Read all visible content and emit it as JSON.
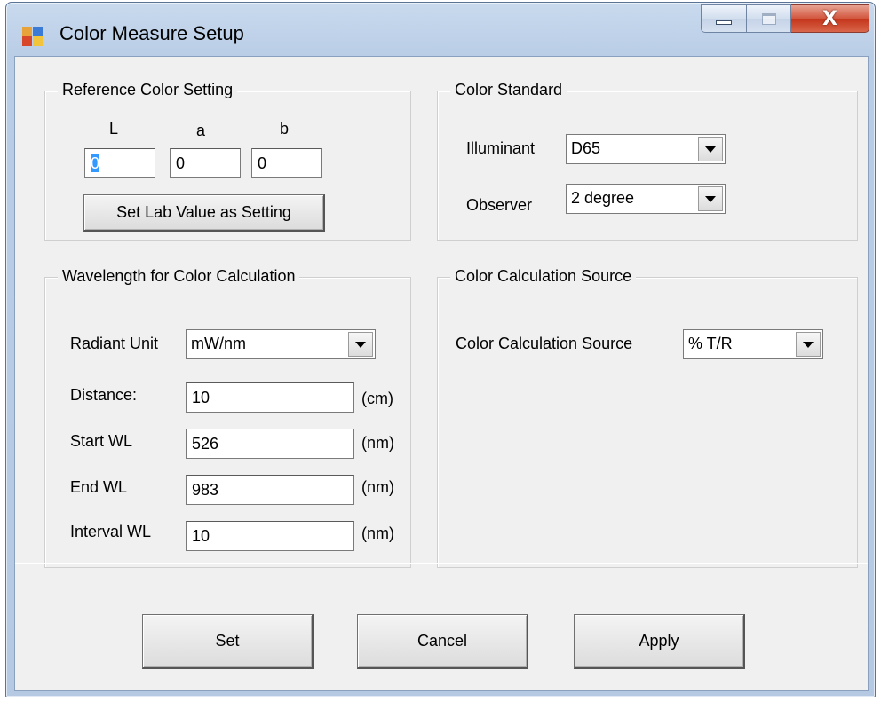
{
  "window": {
    "title": "Color Measure Setup",
    "close_glyph": "X"
  },
  "reference": {
    "legend": "Reference Color Setting",
    "l_label": "L",
    "a_label": "a",
    "b_label": "b",
    "l_value": "0",
    "a_value": "0",
    "b_value": "0",
    "set_button": "Set Lab Value as Setting"
  },
  "standard": {
    "legend": "Color Standard",
    "illuminant_label": "Illuminant",
    "illuminant_value": "D65",
    "observer_label": "Observer",
    "observer_value": "2 degree"
  },
  "wavelength": {
    "legend": "Wavelength for Color Calculation",
    "radiant_label": "Radiant Unit",
    "radiant_value": "mW/nm",
    "distance_label": "Distance:",
    "distance_value": "10",
    "distance_unit": "(cm)",
    "start_label": "Start WL",
    "start_value": "526",
    "start_unit": "(nm)",
    "end_label": "End WL",
    "end_value": "983",
    "end_unit": "(nm)",
    "interval_label": "Interval WL",
    "interval_value": "10",
    "interval_unit": "(nm)"
  },
  "source": {
    "legend": "Color Calculation Source",
    "source_label": "Color Calculation Source",
    "source_value": "% T/R"
  },
  "buttons": {
    "set": "Set",
    "cancel": "Cancel",
    "apply": "Apply"
  },
  "colors": {
    "selection": "#3399ff",
    "dialog_bg": "#f0f0f0",
    "close_button": "#c3341a"
  },
  "icons": [
    "app-icon",
    "minimize-icon",
    "maximize-icon",
    "close-icon",
    "dropdown-arrow-icon"
  ]
}
